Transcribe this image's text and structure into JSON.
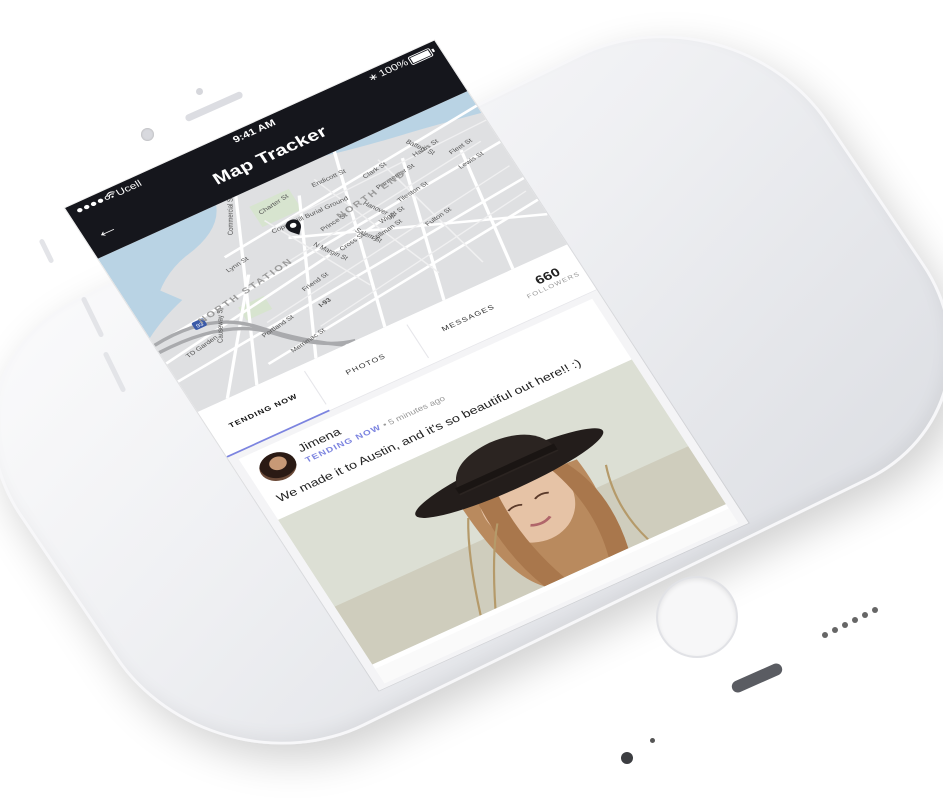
{
  "status_bar": {
    "carrier": "Ucell",
    "time": "9:41 AM",
    "battery": "100%"
  },
  "header": {
    "title": "Map Tracker",
    "back_icon": "back-arrow-icon"
  },
  "map": {
    "streets": [
      "Charter St",
      "Commercial St",
      "Copps Hill Burial Ground",
      "Prince St",
      "Cross St",
      "Friend St",
      "Portland St",
      "Merrimac St",
      "Causeway St",
      "Salem St",
      "N Margin St",
      "Wiget St",
      "Stillman St",
      "Hanover St",
      "Fleet St",
      "Lewis St",
      "Harris St",
      "Endicott St",
      "Parmenter St",
      "Clark St",
      "Lynn St",
      "Battery St",
      "Tileston St",
      "Fulton St"
    ],
    "districts": [
      "NORTH END",
      "NORTH STATION"
    ],
    "highways": [
      "I-93"
    ],
    "route_shield": "93",
    "misc_label": "TD Garden",
    "pin_icon": "map-pin-icon"
  },
  "tabs": [
    {
      "label": "TENDING NOW",
      "active": true
    },
    {
      "label": "PHOTOS",
      "active": false
    },
    {
      "label": "MESSAGES",
      "active": false
    }
  ],
  "followers": {
    "count": "660",
    "label": "FOLLOWERS"
  },
  "post": {
    "author": "Jimena",
    "tag": "TENDING NOW",
    "separator": "•",
    "time_ago": "5 minutes ago",
    "caption": "We made it to Austin, and it's so beautiful out here!! :)"
  },
  "colors": {
    "header_bg": "#15161c",
    "accent": "#7c84e0",
    "map_water": "#b9d3e4",
    "map_park": "#d7e4cf"
  }
}
